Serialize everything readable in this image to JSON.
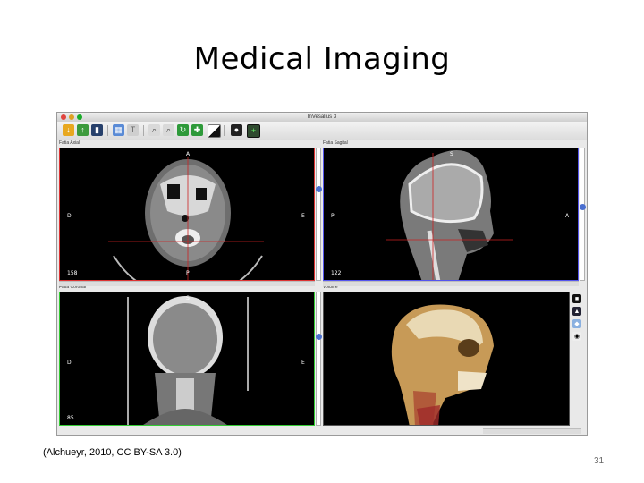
{
  "slide": {
    "title": "Medical Imaging",
    "caption": "(Alchueyr, 2010, CC BY-SA 3.0)",
    "page_number": "31"
  },
  "app": {
    "window_title": "InVesalius 3",
    "toolbar_icons": [
      "import-icon",
      "export-icon",
      "bookmark-icon",
      "layout-icon",
      "text-icon",
      "zoom-in-icon",
      "zoom-region-icon",
      "rotate-icon",
      "pan-icon",
      "contrast-icon",
      "screenshot-icon",
      "crosshair-icon"
    ]
  },
  "panes": {
    "axial": {
      "label": "Fatia Axial",
      "top": "A",
      "left": "D",
      "right": "E",
      "bottom": "P",
      "slice": "158"
    },
    "sagittal": {
      "label": "Fatia Sagital",
      "top": "S",
      "left": "P",
      "right": "A",
      "bottom": "",
      "slice": "122"
    },
    "coronal": {
      "label": "Fatia Coronal",
      "top": "S",
      "left": "D",
      "right": "E",
      "bottom": "",
      "slice": "85"
    },
    "volume": {
      "label": "Volume"
    }
  },
  "colors": {
    "axial_border": "#dd3333",
    "sagittal_border": "#5555ee",
    "coronal_border": "#33cc33",
    "crosshair": "#cc2222"
  }
}
